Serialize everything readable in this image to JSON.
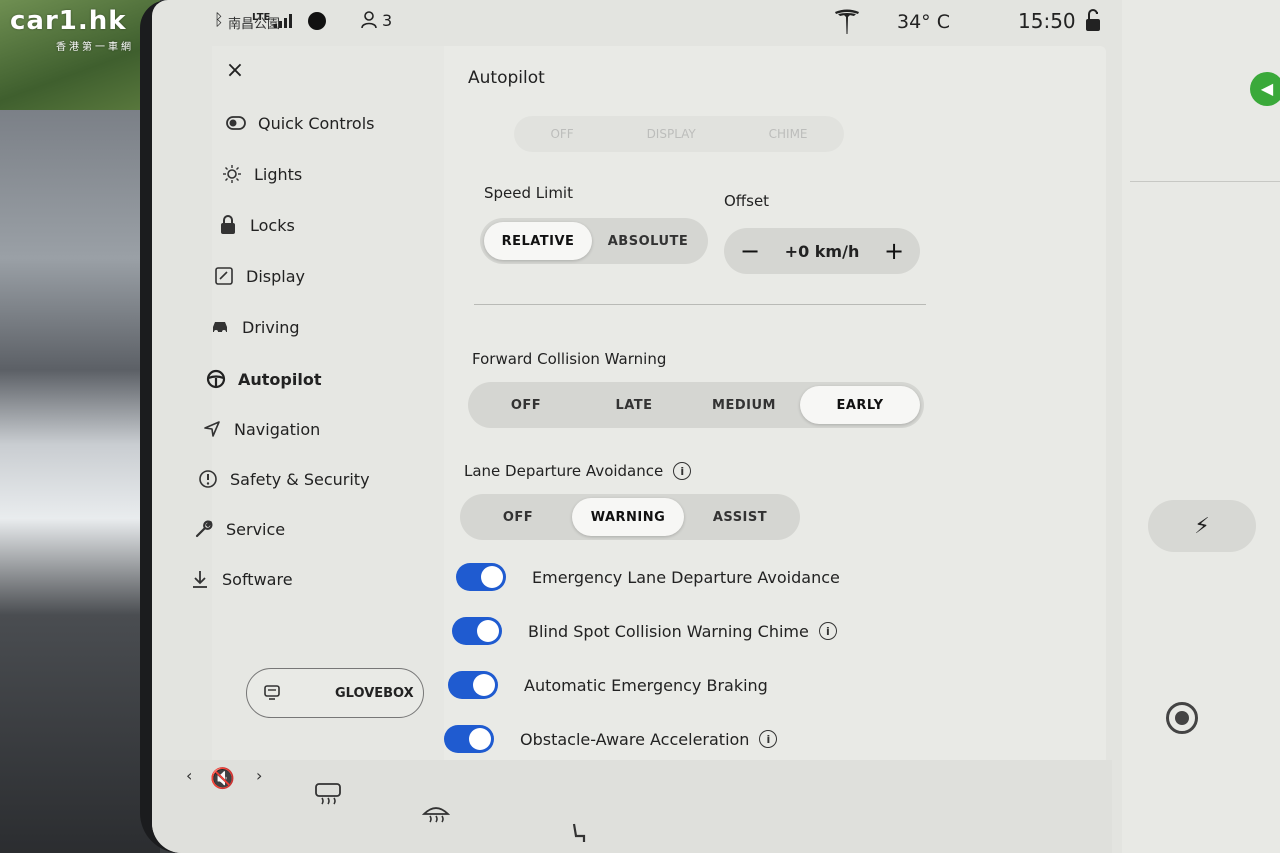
{
  "watermark": {
    "logo": "car1.hk",
    "subtitle": "香港第一車網"
  },
  "statusbar": {
    "bluetooth_icon": "bluetooth-icon",
    "carrier": "南昌公園",
    "network": "LTE",
    "user_count": "3",
    "temperature": "34° C",
    "time": "15:50"
  },
  "sidebar": {
    "close_label": "×",
    "items": [
      {
        "label": "Quick Controls",
        "icon": "toggle-icon"
      },
      {
        "label": "Lights",
        "icon": "bulb-icon"
      },
      {
        "label": "Locks",
        "icon": "lock-icon"
      },
      {
        "label": "Display",
        "icon": "display-icon"
      },
      {
        "label": "Driving",
        "icon": "car-icon"
      },
      {
        "label": "Autopilot",
        "icon": "steering-wheel-icon"
      },
      {
        "label": "Navigation",
        "icon": "navigation-arrow-icon"
      },
      {
        "label": "Safety & Security",
        "icon": "alert-circle-icon"
      },
      {
        "label": "Service",
        "icon": "wrench-icon"
      },
      {
        "label": "Software",
        "icon": "download-icon"
      }
    ],
    "glovebox_label": "GLOVEBOX"
  },
  "content": {
    "title": "Autopilot",
    "ghost_options": [
      "OFF",
      "DISPLAY",
      "CHIME"
    ],
    "speed_limit": {
      "label": "Speed Limit",
      "options": [
        "RELATIVE",
        "ABSOLUTE"
      ],
      "selected": "RELATIVE"
    },
    "offset": {
      "label": "Offset",
      "minus": "−",
      "value": "+0 km/h",
      "plus": "+"
    },
    "fcw": {
      "label": "Forward Collision Warning",
      "options": [
        "OFF",
        "LATE",
        "MEDIUM",
        "EARLY"
      ],
      "selected": "EARLY"
    },
    "lda": {
      "label": "Lane Departure Avoidance",
      "options": [
        "OFF",
        "WARNING",
        "ASSIST"
      ],
      "selected": "WARNING"
    },
    "toggles": [
      {
        "label": "Emergency Lane Departure Avoidance",
        "on": true,
        "info": false
      },
      {
        "label": "Blind Spot Collision Warning Chime",
        "on": true,
        "info": true
      },
      {
        "label": "Automatic Emergency Braking",
        "on": true,
        "info": false
      },
      {
        "label": "Obstacle-Aware Acceleration",
        "on": true,
        "info": true
      }
    ],
    "info_glyph": "i"
  },
  "colors": {
    "toggle_on": "#1f5bd0",
    "green_button": "#3aa93a"
  }
}
